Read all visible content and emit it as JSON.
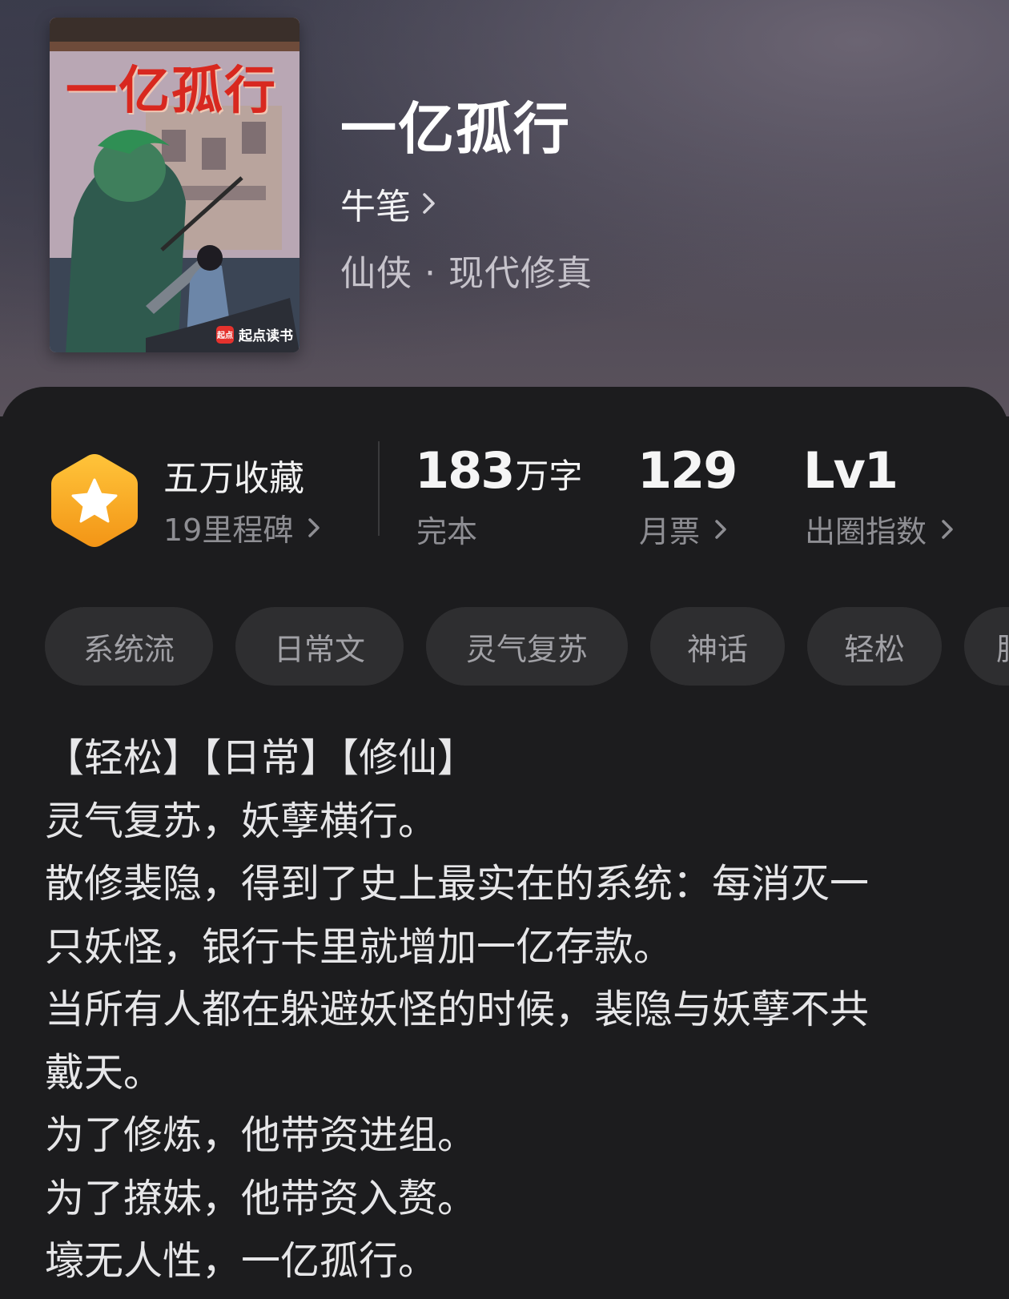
{
  "book": {
    "cover_title": "一亿孤行",
    "cover_publisher": "起点读书",
    "cover_logo_text": "起点",
    "title": "一亿孤行",
    "author": "牛笔",
    "genre": "仙侠 · 现代修真"
  },
  "stats": {
    "milestone_title": "五万收藏",
    "milestone_sub": "19里程碑",
    "word_count": "183",
    "word_unit": "万字",
    "status": "完本",
    "monthly_tickets": "129",
    "monthly_tickets_label": "月票",
    "breakout_level": "Lv1",
    "breakout_label": "出圈指数"
  },
  "tags": [
    "系统流",
    "日常文",
    "灵气复苏",
    "神话",
    "轻松",
    "肥"
  ],
  "description": [
    "【轻松】【日常】【修仙】",
    "灵气复苏，妖孽横行。",
    "散修裴隐，得到了史上最实在的系统：每消灭一",
    "只妖怪，银行卡里就增加一亿存款。",
    "当所有人都在躲避妖怪的时候，裴隐与妖孽不共",
    "戴天。",
    "为了修炼，他带资进组。",
    "为了撩妹，他带资入赘。",
    "壕无人性，一亿孤行。"
  ],
  "colors": {
    "background": "#1c1c1e",
    "tag_bg": "#2e2e30",
    "badge_orange": "#f7a21b",
    "muted_text": "#8e8e93"
  }
}
